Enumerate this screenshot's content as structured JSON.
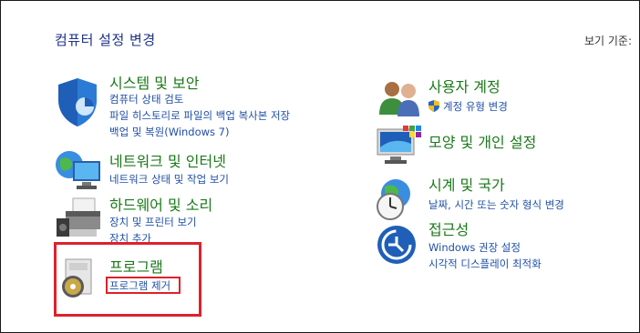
{
  "header": {
    "title": "컴퓨터 설정 변경",
    "view_by_label": "보기 기준:"
  },
  "categories": {
    "system_security": {
      "title": "시스템 및 보안",
      "links": [
        "컴퓨터 상태 검토",
        "파일 히스토리로 파일의 백업 복사본 저장",
        "백업 및 복원(Windows 7)"
      ]
    },
    "network": {
      "title": "네트워크 및 인터넷",
      "links": [
        "네트워크 상태 및 작업 보기"
      ]
    },
    "hardware": {
      "title": "하드웨어 및 소리",
      "links": [
        "장치 및 프린터 보기",
        "장치 추가"
      ]
    },
    "programs": {
      "title": "프로그램",
      "links": [
        "프로그램 제거"
      ]
    },
    "user_accounts": {
      "title": "사용자 계정",
      "links": [
        "계정 유형 변경"
      ]
    },
    "appearance": {
      "title": "모양 및 개인 설정",
      "links": []
    },
    "clock_region": {
      "title": "시계 및 국가",
      "links": [
        "날짜, 시간 또는 숫자 형식 변경"
      ]
    },
    "ease_of_access": {
      "title": "접근성",
      "links": [
        "Windows 권장 설정",
        "시각적 디스플레이 최적화"
      ]
    }
  },
  "colors": {
    "title_text": "#1e3287",
    "category_title": "#1a7a1a",
    "link": "#1f4fa8",
    "highlight": "#e0202a"
  }
}
